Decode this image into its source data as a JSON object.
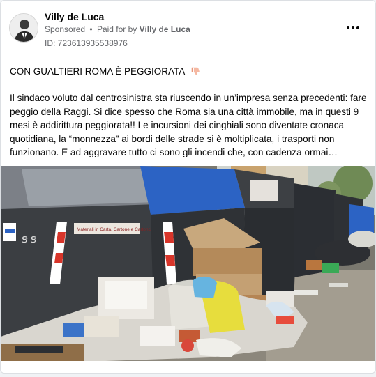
{
  "post": {
    "author": "Villy de Luca",
    "sponsored_label": "Sponsored",
    "separator": "•",
    "paid_for_prefix": "Paid for by",
    "paid_for_name": "Villy de Luca",
    "ad_id": "ID: 723613935538976",
    "headline": "CON GUALTIERI ROMA È PEGGIORATA",
    "headline_icon": "thumbs-down-icon",
    "body": "Il sindaco voluto dal centrosinistra sta riuscendo in un’impresa senza precedenti: fare peggio della Raggi. Si dice spesso che Roma sia una città immobile, ma in questi 9 mesi è addirittura peggiorata!! Le incursioni dei cinghiali sono diventate cronaca quotidiana, la “monnezza” ai bordi delle strade si è moltiplicata, i trasporti non funzionano. E ad aggravare tutto ci sono gli incendi che, con cadenza ormai…",
    "more_icon": "more-options-icon"
  },
  "photo": {
    "description_icon": "photo-overflowing-garbage-bins",
    "bin_sign_text": "Materiali in Carta, Cartone e Cartoncino"
  },
  "colors": {
    "text_primary": "#050505",
    "text_secondary": "#65676b",
    "card_bg": "#ffffff",
    "page_bg": "#f0f2f5",
    "bin_blue": "#2c63c4",
    "bin_dark": "#2c2f33"
  }
}
